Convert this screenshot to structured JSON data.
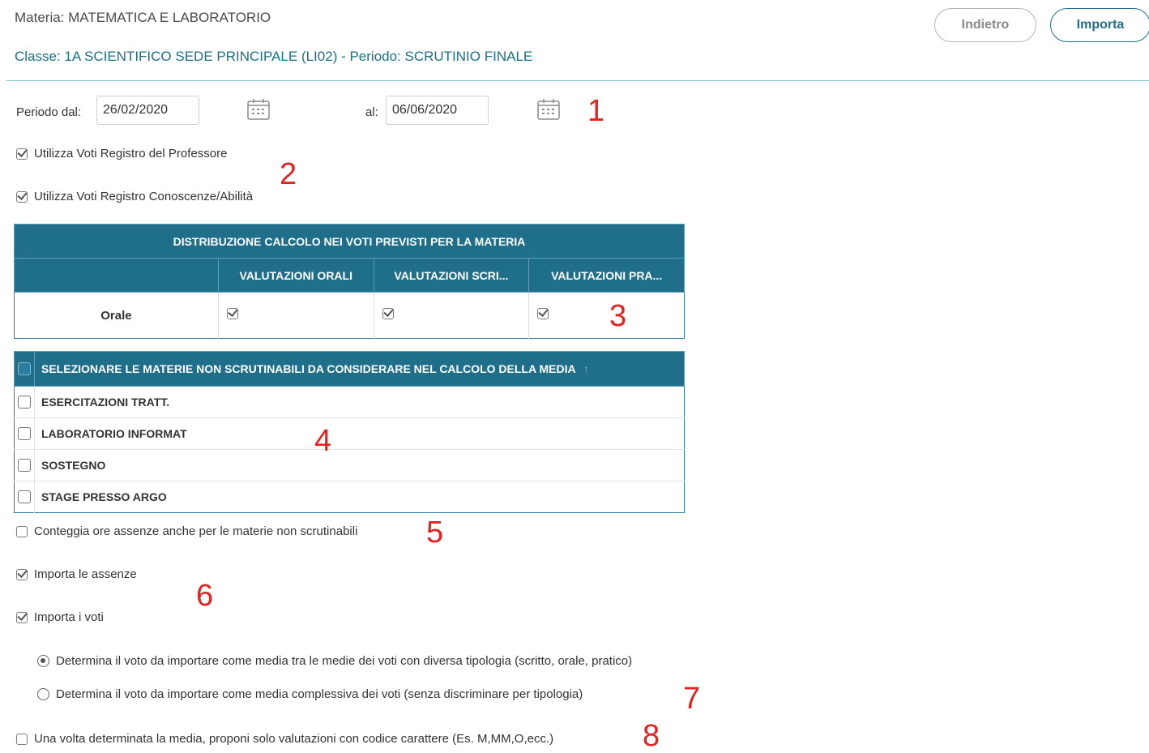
{
  "header": {
    "materia": "Materia: MATEMATICA E LABORATORIO",
    "classe": "Classe: 1A SCIENTIFICO SEDE PRINCIPALE (LI02) - Periodo: SCRUTINIO FINALE"
  },
  "buttons": {
    "back_label": "Indietro",
    "import_label": "Importa"
  },
  "period": {
    "from_label": "Periodo dal:",
    "from_value": "26/02/2020",
    "to_label": "al:",
    "to_value": "06/06/2020"
  },
  "options": {
    "use_teacher_grades": {
      "label": "Utilizza Voti Registro del Professore",
      "checked": true
    },
    "use_knowledge_grades": {
      "label": "Utilizza Voti Registro Conoscenze/Abilità",
      "checked": true
    },
    "count_absences": {
      "label": "Conteggia ore assenze anche per le materie non scrutinabili",
      "checked": false
    },
    "import_absences": {
      "label": "Importa le assenze",
      "checked": true
    },
    "import_grades": {
      "label": "Importa i voti",
      "checked": true
    },
    "radio_mean_of_means": {
      "label": "Determina il voto da importare come media tra le medie dei voti con diversa tipologia (scritto, orale, pratico)",
      "selected": true
    },
    "radio_overall_mean": {
      "label": "Determina il voto da importare come media complessiva dei voti (senza discriminare per tipologia)",
      "selected": false
    },
    "char_code_only": {
      "label": "Una volta determinata la media, proponi solo valutazioni con codice carattere (Es. M,MM,O,ecc.)",
      "checked": false
    }
  },
  "distribution_table": {
    "title": "DISTRIBUZIONE CALCOLO NEI VOTI PREVISTI PER LA MATERIA",
    "columns": [
      "VALUTAZIONI ORALI",
      "VALUTAZIONI SCRI...",
      "VALUTAZIONI PRA..."
    ],
    "row_label": "Orale",
    "row_checks": [
      true,
      true,
      true
    ]
  },
  "subjects_table": {
    "header": "SELEZIONARE LE MATERIE NON SCRUTINABILI DA CONSIDERARE NEL CALCOLO DELLA MEDIA",
    "sort_icon": "arrow-up-icon",
    "rows": [
      "ESERCITAZIONI TRATT.",
      "LABORATORIO INFORMAT",
      "SOSTEGNO",
      "STAGE PRESSO ARGO"
    ]
  },
  "annotations": [
    "1",
    "2",
    "3",
    "4",
    "5",
    "6",
    "7",
    "8"
  ],
  "colors": {
    "accent": "#1f6f8b",
    "annotation_red": "#e52222",
    "separator": "#8fc9c9"
  }
}
